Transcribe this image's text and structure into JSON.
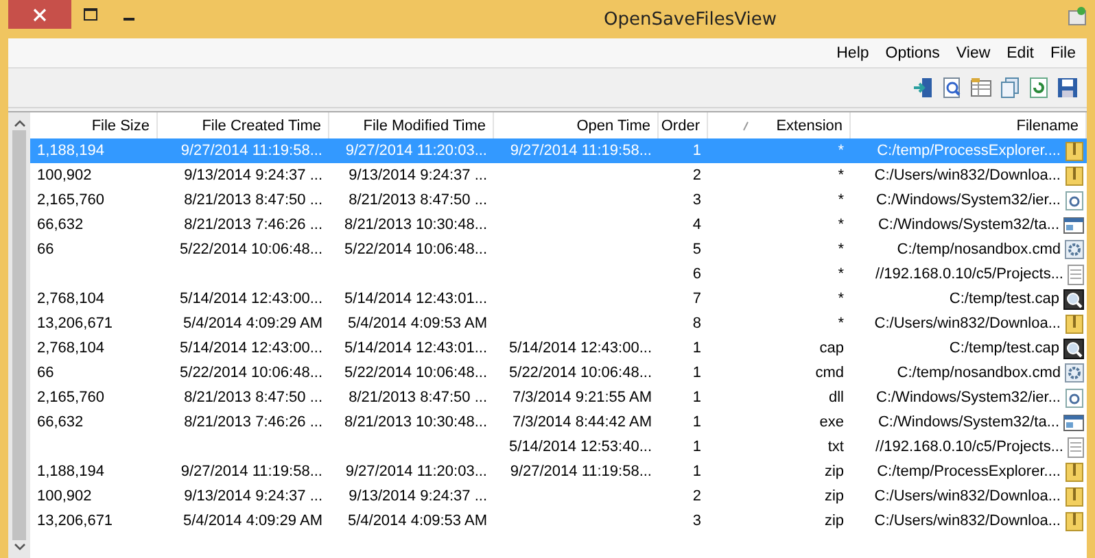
{
  "window": {
    "title": "OpenSaveFilesView"
  },
  "menu": [
    "Help",
    "Options",
    "View",
    "Edit",
    "File"
  ],
  "table": {
    "columns": [
      {
        "label": "File Size"
      },
      {
        "label": "File Created Time"
      },
      {
        "label": "File Modified Time"
      },
      {
        "label": "Open Time"
      },
      {
        "label": "Order"
      },
      {
        "label": "Extension",
        "sorted": true
      },
      {
        "label": "Filename"
      }
    ],
    "rows": [
      {
        "kind": "zip",
        "selected": true,
        "cells": [
          "1,188,194",
          "9/27/2014 11:19:58...",
          "9/27/2014 11:20:03...",
          "9/27/2014 11:19:58...",
          "1",
          "*",
          "C:/temp/ProcessExplorer...."
        ]
      },
      {
        "kind": "zip",
        "selected": false,
        "cells": [
          "100,902",
          "9/13/2014 9:24:37 ...",
          "9/13/2014 9:24:37 ...",
          null,
          "2",
          "*",
          "C:/Users/win832/Downloa..."
        ]
      },
      {
        "kind": "dll",
        "selected": false,
        "cells": [
          "2,165,760",
          "8/21/2013 8:47:50 ...",
          "8/21/2013 8:47:50 ...",
          null,
          "3",
          "*",
          "C:/Windows/System32/ier..."
        ]
      },
      {
        "kind": "exe",
        "selected": false,
        "cells": [
          "66,632",
          "8/21/2013 7:46:26 ...",
          "8/21/2013 10:30:48...",
          null,
          "4",
          "*",
          "C:/Windows/System32/ta..."
        ]
      },
      {
        "kind": "cmd",
        "selected": false,
        "cells": [
          "66",
          "5/22/2014 10:06:48...",
          "5/22/2014 10:06:48...",
          null,
          "5",
          "*",
          "C:/temp/nosandbox.cmd"
        ]
      },
      {
        "kind": "txt",
        "selected": false,
        "cells": [
          null,
          null,
          null,
          null,
          "6",
          "*",
          "//192.168.0.10/c5/Projects..."
        ]
      },
      {
        "kind": "cap",
        "selected": false,
        "cells": [
          "2,768,104",
          "5/14/2014 12:43:00...",
          "5/14/2014 12:43:01...",
          null,
          "7",
          "*",
          "C:/temp/test.cap"
        ]
      },
      {
        "kind": "zip",
        "selected": false,
        "cells": [
          "13,206,671",
          "5/4/2014 4:09:29 AM",
          "5/4/2014 4:09:53 AM",
          null,
          "8",
          "*",
          "C:/Users/win832/Downloa..."
        ]
      },
      {
        "kind": "cap",
        "selected": false,
        "cells": [
          "2,768,104",
          "5/14/2014 12:43:00...",
          "5/14/2014 12:43:01...",
          "5/14/2014 12:43:00...",
          "1",
          "cap",
          "C:/temp/test.cap"
        ]
      },
      {
        "kind": "cmd",
        "selected": false,
        "cells": [
          "66",
          "5/22/2014 10:06:48...",
          "5/22/2014 10:06:48...",
          "5/22/2014 10:06:48...",
          "1",
          "cmd",
          "C:/temp/nosandbox.cmd"
        ]
      },
      {
        "kind": "dll",
        "selected": false,
        "cells": [
          "2,165,760",
          "8/21/2013 8:47:50 ...",
          "8/21/2013 8:47:50 ...",
          "7/3/2014 9:21:55 AM",
          "1",
          "dll",
          "C:/Windows/System32/ier..."
        ]
      },
      {
        "kind": "exe",
        "selected": false,
        "cells": [
          "66,632",
          "8/21/2013 7:46:26 ...",
          "8/21/2013 10:30:48...",
          "7/3/2014 8:44:42 AM",
          "1",
          "exe",
          "C:/Windows/System32/ta..."
        ]
      },
      {
        "kind": "txt",
        "selected": false,
        "cells": [
          null,
          null,
          null,
          "5/14/2014 12:53:40...",
          "1",
          "txt",
          "//192.168.0.10/c5/Projects..."
        ]
      },
      {
        "kind": "zip",
        "selected": false,
        "cells": [
          "1,188,194",
          "9/27/2014 11:19:58...",
          "9/27/2014 11:20:03...",
          "9/27/2014 11:19:58...",
          "1",
          "zip",
          "C:/temp/ProcessExplorer...."
        ]
      },
      {
        "kind": "zip",
        "selected": false,
        "cells": [
          "100,902",
          "9/13/2014 9:24:37 ...",
          "9/13/2014 9:24:37 ...",
          null,
          "2",
          "zip",
          "C:/Users/win832/Downloa..."
        ]
      },
      {
        "kind": "zip",
        "selected": false,
        "cells": [
          "13,206,671",
          "5/4/2014 4:09:29 AM",
          "5/4/2014 4:09:53 AM",
          null,
          "3",
          "zip",
          "C:/Users/win832/Downloa..."
        ]
      }
    ]
  }
}
